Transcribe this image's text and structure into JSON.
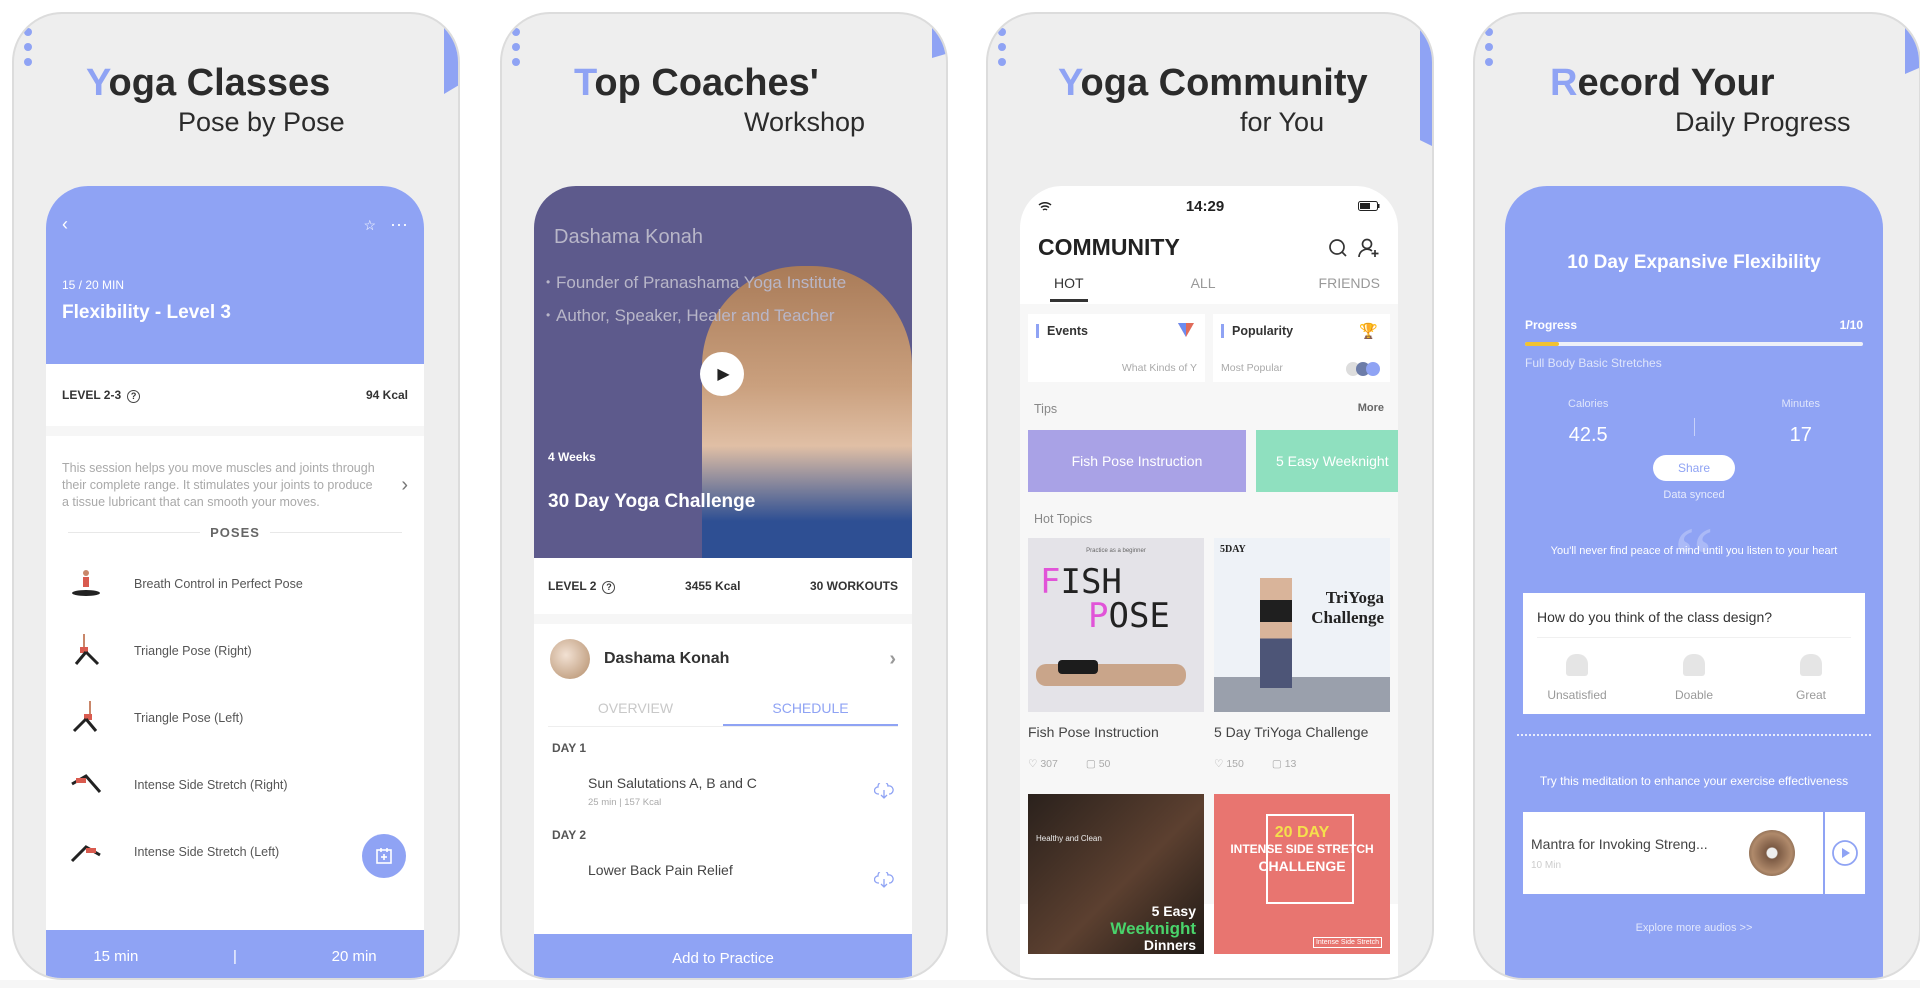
{
  "colors": {
    "accent": "#8fa3f4",
    "hero_bg": "#5d5a8c",
    "tip_purple": "#a9a2e6",
    "tip_green": "#8fe0bf",
    "progress_fill": "#f1c232"
  },
  "panels": [
    {
      "headline_cap": "Y",
      "headline_rest": "oga Classes",
      "subline": "Pose by Pose"
    },
    {
      "headline_cap": "T",
      "headline_rest": "op Coaches'",
      "subline": "Workshop"
    },
    {
      "headline_cap": "Y",
      "headline_rest": "oga Community",
      "subline": "for You"
    },
    {
      "headline_cap": "R",
      "headline_rest": "ecord Your",
      "subline": "Daily Progress"
    }
  ],
  "classes": {
    "icons": {
      "back": "chevron-left-icon",
      "star": "star-icon",
      "more": "more-dots-icon"
    },
    "minutes": "15 / 20 MIN",
    "title": "Flexibility - Level 3",
    "level": "LEVEL 2-3",
    "kcal": "94 Kcal",
    "description": "This session helps you move muscles and joints through their complete range. It stimulates your joints to produce a tissue lubricant that can smooth your moves.",
    "poses_header": "POSES",
    "poses": [
      {
        "name": "Breath Control in Perfect Pose"
      },
      {
        "name": "Triangle Pose (Right)"
      },
      {
        "name": "Triangle Pose (Left)"
      },
      {
        "name": "Intense Side Stretch (Right)"
      },
      {
        "name": "Intense Side Stretch (Left)"
      }
    ],
    "footer": {
      "left": "15 min",
      "sep": "|",
      "right": "20 min"
    }
  },
  "coaches": {
    "coach_name": "Dashama Konah",
    "bullets": [
      "Founder of Pranashama Yoga Institute",
      "Author, Speaker, Healer and Teacher"
    ],
    "weeks": "4 Weeks",
    "program_title": "30 Day Yoga Challenge",
    "level": "LEVEL 2",
    "kcal": "3455 Kcal",
    "workouts": "30 WORKOUTS",
    "tabs": [
      {
        "label": "OVERVIEW",
        "active": false
      },
      {
        "label": "SCHEDULE",
        "active": true
      }
    ],
    "schedule": [
      {
        "day": "DAY 1",
        "session": "Sun Salutations A, B and C",
        "meta": "25 min  |  157 Kcal"
      },
      {
        "day": "DAY 2",
        "session": "Lower Back Pain Relief",
        "meta": ""
      }
    ],
    "cta": "Add to Practice"
  },
  "community": {
    "status_time": "14:29",
    "title": "COMMUNITY",
    "tabs": [
      {
        "label": "HOT",
        "active": true
      },
      {
        "label": "ALL",
        "active": false
      },
      {
        "label": "FRIENDS",
        "active": false
      }
    ],
    "cards": [
      {
        "title": "Events",
        "subtitle": "What Kinds of Y"
      },
      {
        "title": "Popularity",
        "subtitle": "Most Popular"
      }
    ],
    "tips_label": "Tips",
    "more_label": "More",
    "tips": [
      "Fish Pose Instruction",
      "5 Easy Weeknight"
    ],
    "hot_topics_label": "Hot Topics",
    "topics": [
      {
        "caption": "Fish Pose Instruction",
        "likes": "307",
        "comments": "50",
        "img_text1": "FISH",
        "img_text2": "POSE",
        "img_small": "Practice as a beginner"
      },
      {
        "caption": "5 Day TriYoga Challenge",
        "likes": "150",
        "comments": "13",
        "img_text1": "TriYoga",
        "img_text2": "Challenge",
        "img_small": "5DAY"
      }
    ],
    "topics_row2": [
      {
        "img_text1": "5 Easy",
        "img_text2": "Weeknight",
        "img_text3": "Dinners",
        "img_small": "Healthy and Clean"
      },
      {
        "img_text1": "20 DAY",
        "img_text2": "INTENSE SIDE STRETCH",
        "img_text3": "CHALLENGE",
        "img_small": "Intense Side Stretch"
      }
    ]
  },
  "progress": {
    "title": "10 Day Expansive Flexibility",
    "progress_label": "Progress",
    "progress_count": "1/10",
    "progress_fraction": 0.1,
    "session": "Full Body Basic Stretches",
    "calories_label": "Calories",
    "calories": "42.5",
    "minutes_label": "Minutes",
    "minutes": "17",
    "share": "Share",
    "synced": "Data synced",
    "quote": "You'll never find peace of mind until you listen to your heart",
    "survey_question": "How do you think of the class design?",
    "survey_options": [
      "Unsatisfied",
      "Doable",
      "Great"
    ],
    "meditation_prompt": "Try this meditation to enhance your exercise effectiveness",
    "audio_title": "Mantra for Invoking Streng...",
    "audio_duration": "10 Min",
    "explore": "Explore more audios >>"
  }
}
